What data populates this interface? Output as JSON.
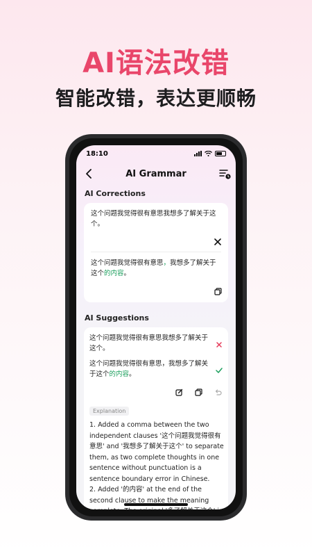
{
  "hero": {
    "title": "AI语法改错",
    "subtitle": "智能改错，表达更顺畅"
  },
  "status_bar": {
    "time": "18:10"
  },
  "nav": {
    "title": "AI Grammar"
  },
  "corrections": {
    "title": "AI Corrections",
    "original_text": "这个问题我觉得很有意思我想多了解关于这个。",
    "corrected_prefix": "这个问题我觉得很有意思",
    "corrected_comma": "，",
    "corrected_middle": "我想多了解关于这个",
    "corrected_added": "的内容",
    "corrected_end": "。"
  },
  "suggestions": {
    "title": "AI Suggestions",
    "original_text": "这个问题我觉得很有意思我想多了解关于这个。",
    "suggested_prefix": "这个问题我觉得很有意思，我想多了解关于这个",
    "suggested_added": "的内容",
    "suggested_end": "。",
    "explanation_label": "Explanation",
    "explanation_text": "1. Added a comma between the two independent clauses '这个问题我觉得很有意思' and '我想多了解关于这个' to separate them, as two complete thoughts in one sentence without punctuation is a sentence boundary error in Chinese.\n2. Added '的内容' at the end of the second clause to make the meaning complete. The original '多了解关于这个' is"
  },
  "colors": {
    "accent": "#e9466a",
    "correct_green": "#1a9e5c",
    "reject_red": "#e53b5a"
  },
  "icons": [
    "back-chevron-icon",
    "history-list-icon",
    "close-x-icon",
    "copy-icon",
    "reject-x-icon",
    "accept-check-icon",
    "edit-icon",
    "undo-icon"
  ]
}
